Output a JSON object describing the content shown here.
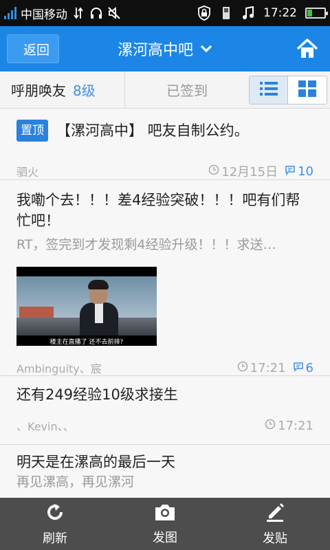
{
  "status_bar": {
    "carrier": "中国移动",
    "time": "17:22"
  },
  "header": {
    "back_label": "返回",
    "title": "漯河高中吧"
  },
  "toolbar": {
    "call_friends": "呼朋唤友",
    "level": "8级",
    "signed_in": "已签到"
  },
  "posts": [
    {
      "badge": "置顶",
      "title": "【漯河高中】 吧友自制公约。",
      "author": "驷火",
      "time": "12月15日",
      "replies": "10"
    },
    {
      "title": "我嘞个去！！！差4经验突破！！！吧有们帮忙吧！",
      "excerpt": "RT，签完到才发现剩4经验升级！！！求送…",
      "image_caption": "楼主在直播了  还不去前排?",
      "author": "Ambinguity、宸",
      "time": "17:21",
      "replies": "6"
    },
    {
      "title": "还有249经验10级求接生",
      "author": "、Kevin、、",
      "time": "17:21"
    },
    {
      "title": "明天是在漯高的最后一天",
      "excerpt": "再见漯高，再见漯河"
    }
  ],
  "bottom_bar": {
    "refresh": "刷新",
    "image_post": "发图",
    "new_post": "发贴"
  },
  "colors": {
    "header_blue": "#1b86e6",
    "accent_blue": "#3f8ee6",
    "bottom_bar": "#4d4d4d"
  }
}
